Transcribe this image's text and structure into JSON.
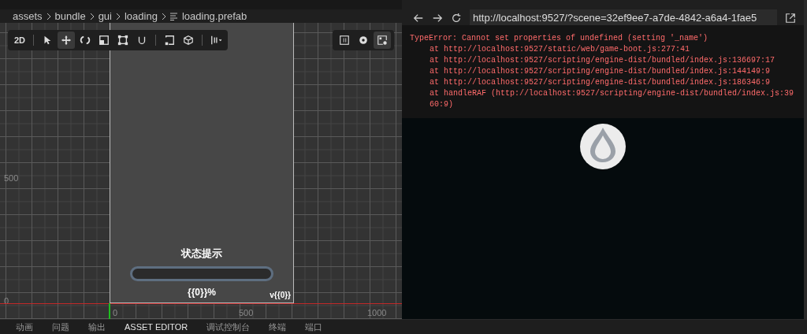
{
  "breadcrumb": [
    "assets",
    "bundle",
    "gui",
    "loading"
  ],
  "file": "loading.prefab",
  "scene": {
    "y_labels": [
      "500",
      "0"
    ],
    "x_labels": [
      "0",
      "500",
      "1000"
    ],
    "tools": [
      {
        "kind": "mode",
        "label": "2D",
        "selected": false
      },
      {
        "kind": "select",
        "selected": false
      },
      {
        "kind": "move",
        "selected": true
      },
      {
        "kind": "rotate",
        "selected": false
      },
      {
        "kind": "scale",
        "selected": false
      },
      {
        "kind": "rect",
        "selected": false
      },
      {
        "kind": "snap",
        "selected": false
      },
      {
        "kind": "frame",
        "selected": false
      },
      {
        "kind": "cube",
        "selected": false
      },
      {
        "kind": "align",
        "selected": false
      }
    ],
    "view_tools": [
      {
        "kind": "panel",
        "selected": false
      },
      {
        "kind": "settings",
        "selected": false
      },
      {
        "kind": "image",
        "selected": true
      }
    ],
    "canvas": {
      "status": "状态提示",
      "progress": {
        "level": 0
      },
      "percent": "{{0}}%",
      "version": "v{{0}}"
    }
  },
  "browser": {
    "url": "http://localhost:9527/?scene=32ef9ee7-a7de-4842-a6a4-1fae5",
    "error_lines": [
      {
        "kind": "message",
        "text": "TypeError: Cannot set properties of undefined (setting '_name')"
      },
      {
        "kind": "frame",
        "text": "at http://localhost:9527/static/web/game-boot.js:277:41"
      },
      {
        "kind": "frame",
        "text": "at http://localhost:9527/scripting/engine-dist/bundled/index.js:136697:17"
      },
      {
        "kind": "frame",
        "text": "at http://localhost:9527/scripting/engine-dist/bundled/index.js:144149:9"
      },
      {
        "kind": "frame",
        "text": "at http://localhost:9527/scripting/engine-dist/bundled/index.js:186346:9"
      },
      {
        "kind": "frame",
        "text": "at handleRAF (http://localhost:9527/scripting/engine-dist/bundled/index.js:3960:9)"
      }
    ]
  },
  "bottom_tabs": [
    {
      "label": "动画",
      "selected": false
    },
    {
      "label": "问题",
      "selected": false
    },
    {
      "label": "输出",
      "selected": false
    },
    {
      "label": "ASSET EDITOR",
      "selected": true
    },
    {
      "label": "调试控制台",
      "selected": false
    },
    {
      "label": "终端",
      "selected": false
    },
    {
      "label": "端口",
      "selected": false
    }
  ]
}
